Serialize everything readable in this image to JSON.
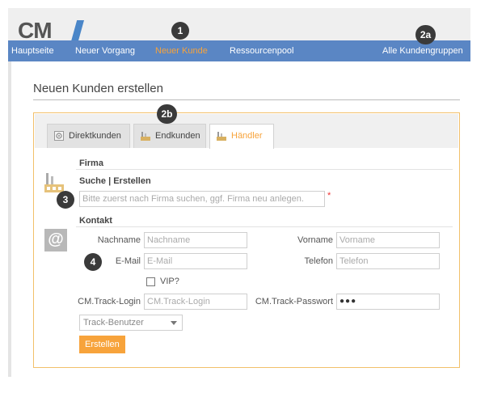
{
  "logo": {
    "text": "CM"
  },
  "nav": {
    "items": [
      "Hauptseite",
      "Neuer Vorgang",
      "Neuer Kunde",
      "Ressourcenpool"
    ],
    "right": "Alle Kundengruppen"
  },
  "markers": {
    "m1": "1",
    "m2a": "2a",
    "m2b": "2b",
    "m3": "3",
    "m4": "4"
  },
  "page": {
    "title": "Neuen Kunden erstellen"
  },
  "tabs": [
    "Direktkunden",
    "Endkunden",
    "Händler"
  ],
  "firma": {
    "heading": "Firma",
    "subheading": "Suche | Erstellen",
    "search_placeholder": "Bitte zuerst nach Firma suchen, ggf. Firma neu anlegen.",
    "required_mark": "*"
  },
  "kontakt": {
    "heading": "Kontakt",
    "nachname_label": "Nachname",
    "nachname_placeholder": "Nachname",
    "vorname_label": "Vorname",
    "vorname_placeholder": "Vorname",
    "email_label": "E-Mail",
    "email_placeholder": "E-Mail",
    "telefon_label": "Telefon",
    "telefon_placeholder": "Telefon",
    "vip_label": "VIP?",
    "login_label": "CM.Track-Login",
    "login_placeholder": "CM.Track-Login",
    "password_label": "CM.Track-Passwort",
    "password_value": "●●●",
    "track_select": "Track-Benutzer",
    "submit": "Erstellen"
  },
  "icons": {
    "firm": "factory-icon",
    "contact": "at-icon"
  },
  "colors": {
    "nav_bg": "#5a86c4",
    "accent": "#f7a33b",
    "panel_border": "#f2c06a"
  }
}
